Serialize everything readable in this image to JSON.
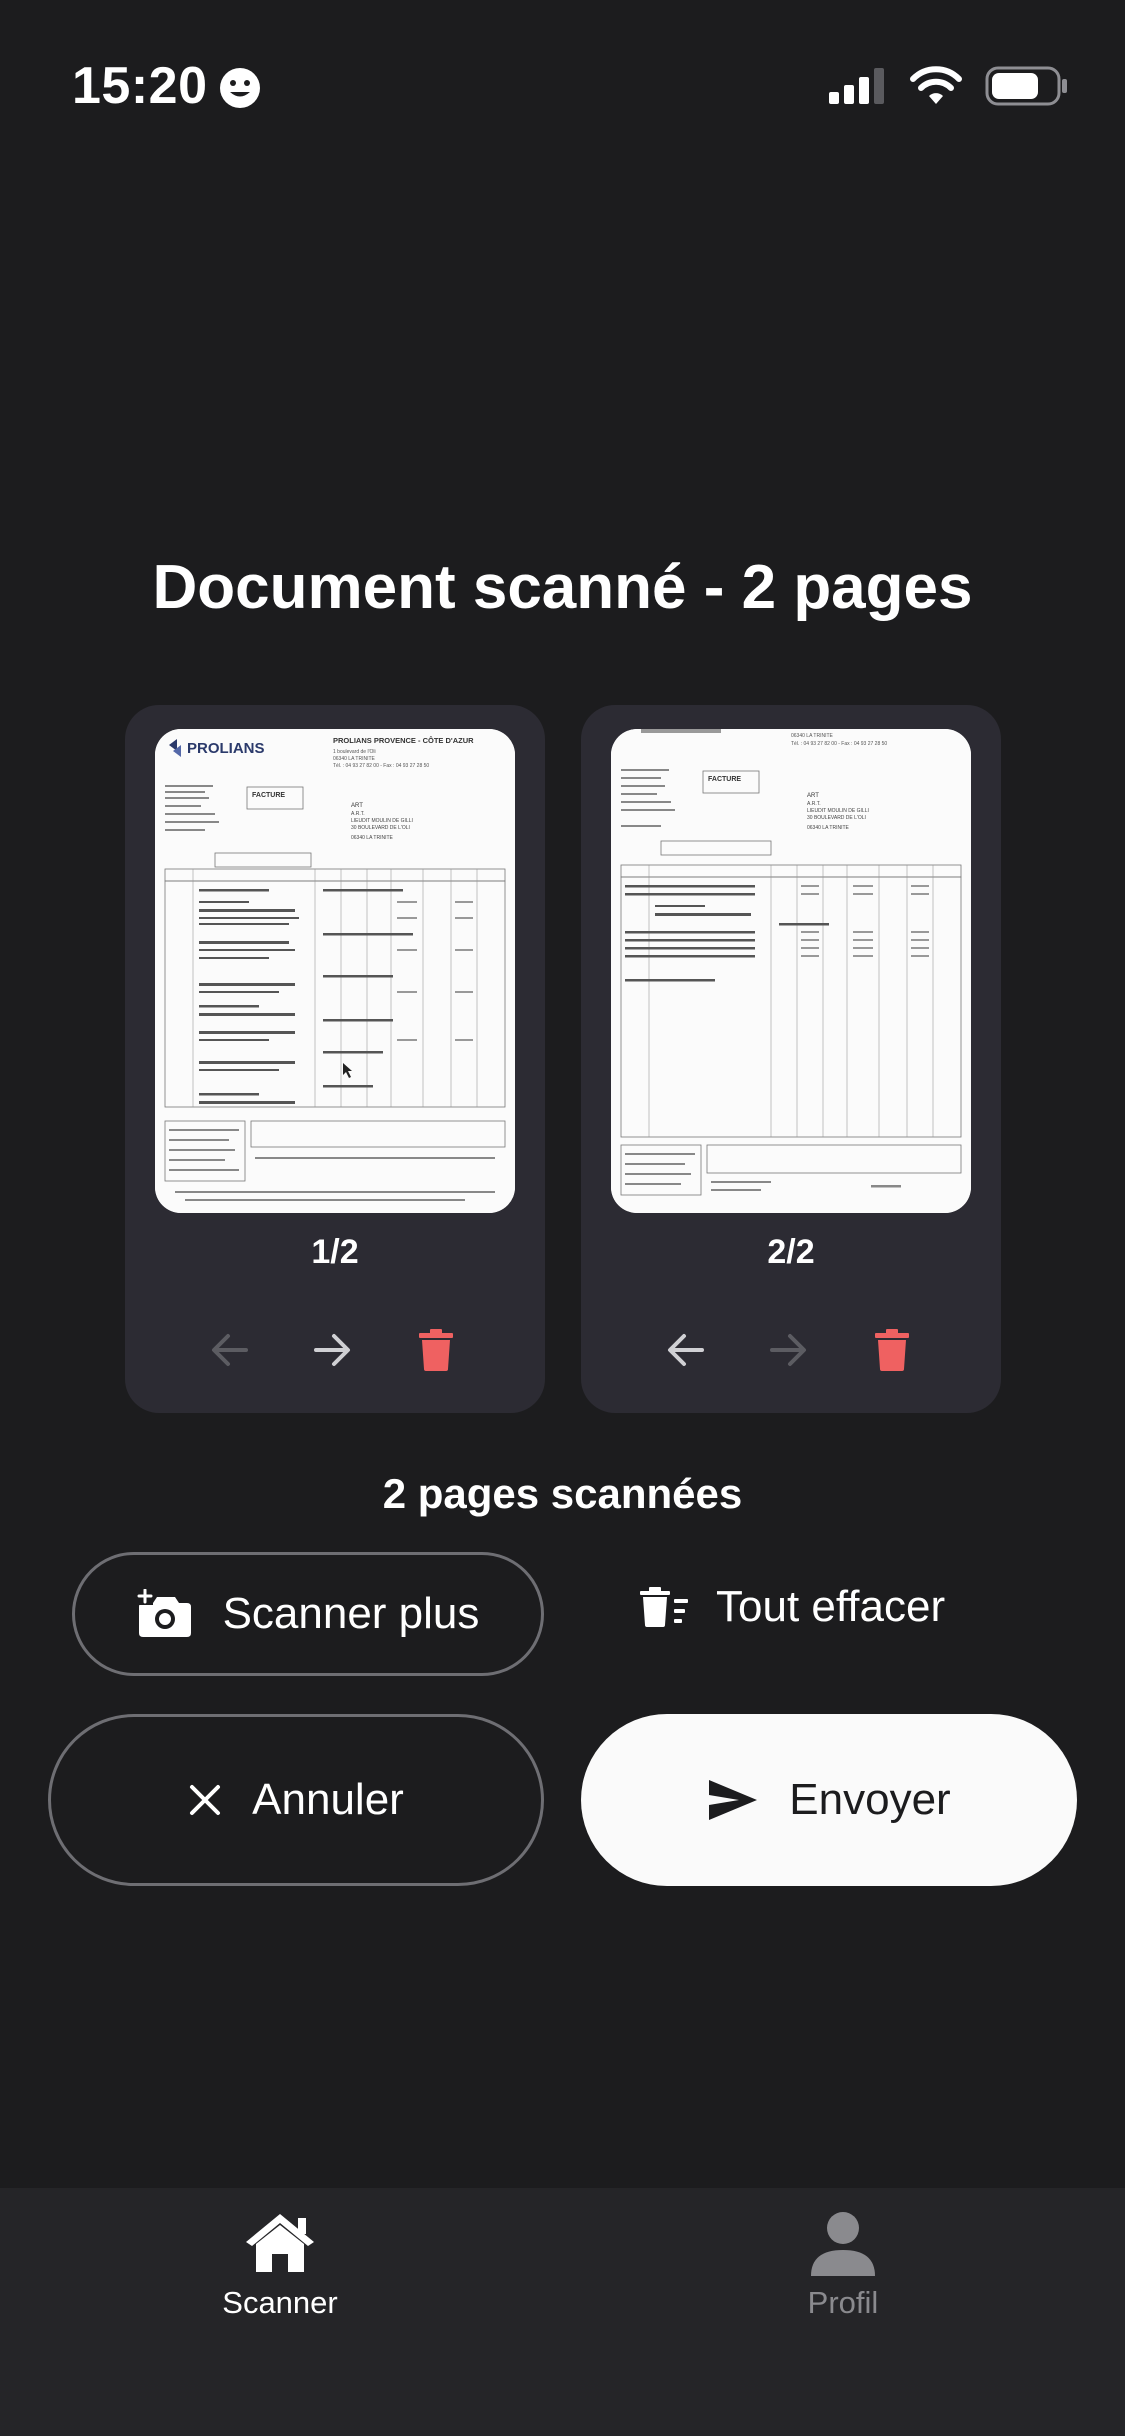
{
  "status_bar": {
    "time": "15:20"
  },
  "header": {
    "title": "Document scanné - 2 pages"
  },
  "pages": [
    {
      "label": "1/2"
    },
    {
      "label": "2/2"
    }
  ],
  "summary": "2 pages scannées",
  "actions": {
    "scan_more": "Scanner plus",
    "clear_all": "Tout effacer",
    "cancel": "Annuler",
    "send": "Envoyer"
  },
  "tabs": [
    {
      "label": "Scanner",
      "icon": "home-icon",
      "active": true
    },
    {
      "label": "Profil",
      "icon": "person-icon",
      "active": false
    }
  ],
  "colors": {
    "delete": "#ef6161",
    "background": "#1c1c1e",
    "card": "#2c2b33"
  },
  "doc_page1": {
    "brand": "PROLIANS",
    "company": "PROLIANS PROVENCE - CÔTE D'AZUR",
    "addr1": "1 boulevard de l'Oli",
    "addr2": "06340 LA TRINITE",
    "phone": "Tél. : 04 93 27 82 00 - Fax : 04 93 27 28 50",
    "doc_type": "FACTURE",
    "client": "ART",
    "client2": "A.R.T.",
    "client3": "LIEUDIT MOULIN DE GILLI",
    "client4": "30 BOULEVARD DE L'OLI",
    "client5": "06340 LA TRINITE"
  },
  "doc_page2": {
    "addr": "06340 LA TRINITE",
    "phone": "Tél. : 04 93 27 82 00 - Fax : 04 93 27 28 50",
    "doc_type": "FACTURE",
    "client": "ART",
    "client2": "A.R.T.",
    "client3": "LIEUDIT MOULIN DE GILLI",
    "client4": "30 BOULEVARD DE L'OLI",
    "client5": "06340 LA TRINITE"
  }
}
